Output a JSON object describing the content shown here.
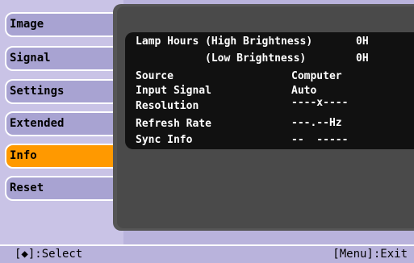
{
  "menu": {
    "items": [
      {
        "label": "Image"
      },
      {
        "label": "Signal"
      },
      {
        "label": "Settings"
      },
      {
        "label": "Extended"
      },
      {
        "label": "Info"
      },
      {
        "label": "Reset"
      }
    ],
    "selected": "Info"
  },
  "info": {
    "lamp_hours_high_label": "Lamp Hours (High Brightness)",
    "lamp_hours_high_value": "0H",
    "lamp_hours_low_label": "(Low Brightness)",
    "lamp_hours_low_value": "0H",
    "source_label": "Source",
    "source_value": "Computer",
    "input_signal_label": "Input Signal",
    "input_signal_value": "Auto",
    "resolution_label": "Resolution",
    "resolution_value": "----x----",
    "refresh_rate_label": "Refresh Rate",
    "refresh_rate_value": "---.--Hz",
    "sync_info_label": "Sync Info",
    "sync_info_value": "--  -----"
  },
  "status_bar": {
    "left": "[◆]:Select",
    "right": "[Menu]:Exit"
  },
  "colors": {
    "menu_bg": "#a8a3d2",
    "active_item": "#ff9900",
    "panel_bg": "#4a4a4a",
    "info_box_bg": "#111111"
  }
}
